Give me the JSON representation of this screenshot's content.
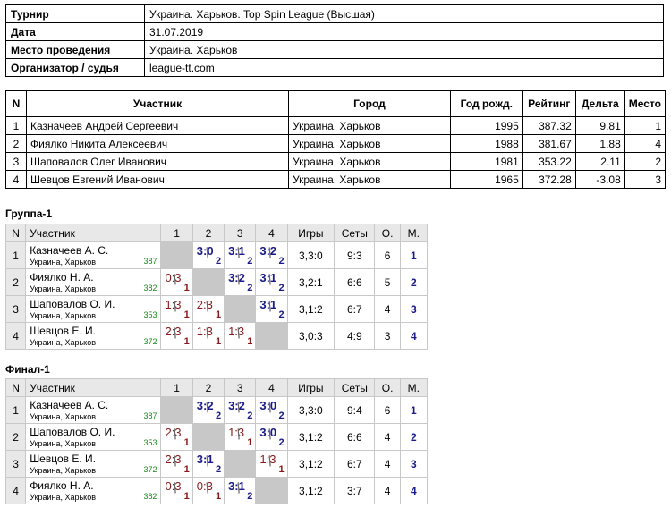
{
  "info": [
    {
      "label": "Турнир",
      "value": "Украина. Харьков. Top Spin League (Высшая)"
    },
    {
      "label": "Дата",
      "value": "31.07.2019"
    },
    {
      "label": "Место проведения",
      "value": "Украина. Харьков"
    },
    {
      "label": "Организатор / судья",
      "value": "league-tt.com"
    }
  ],
  "participants": {
    "headers": [
      "N",
      "Участник",
      "Город",
      "Год рожд.",
      "Рейтинг",
      "Дельта",
      "Место"
    ],
    "rows": [
      {
        "n": "1",
        "name": "Казначеев Андрей Сергеевич",
        "city": "Украина, Харьков",
        "year": "1995",
        "rating": "387.32",
        "delta": "9.81",
        "place": "1"
      },
      {
        "n": "2",
        "name": "Фиялко Никита Алексеевич",
        "city": "Украина, Харьков",
        "year": "1988",
        "rating": "381.67",
        "delta": "1.88",
        "place": "4"
      },
      {
        "n": "3",
        "name": "Шаповалов Олег Иванович",
        "city": "Украина, Харьков",
        "year": "1981",
        "rating": "353.22",
        "delta": "2.11",
        "place": "2"
      },
      {
        "n": "4",
        "name": "Шевцов Евгений Иванович",
        "city": "Украина, Харьков",
        "year": "1965",
        "rating": "372.28",
        "delta": "-3.08",
        "place": "3"
      }
    ]
  },
  "groups": [
    {
      "title": "Группа-1",
      "headers": [
        "N",
        "Участник",
        "1",
        "2",
        "3",
        "4",
        "Игры",
        "Сеты",
        "О.",
        "М."
      ],
      "rows": [
        {
          "n": "1",
          "name": "Казначеев А. С.",
          "city": "Украина, Харьков",
          "rating": "387",
          "results": [
            null,
            {
              "s": "3:0",
              "p": "2",
              "w": true
            },
            {
              "s": "3:1",
              "p": "2",
              "w": true
            },
            {
              "s": "3:2",
              "p": "2",
              "w": true
            }
          ],
          "games": "3,3:0",
          "sets": "9:3",
          "points": "6",
          "place": "1"
        },
        {
          "n": "2",
          "name": "Фиялко Н. А.",
          "city": "Украина, Харьков",
          "rating": "382",
          "results": [
            {
              "s": "0:3",
              "p": "1",
              "w": false
            },
            null,
            {
              "s": "3:2",
              "p": "2",
              "w": true
            },
            {
              "s": "3:1",
              "p": "2",
              "w": true
            }
          ],
          "games": "3,2:1",
          "sets": "6:6",
          "points": "5",
          "place": "2"
        },
        {
          "n": "3",
          "name": "Шаповалов О. И.",
          "city": "Украина, Харьков",
          "rating": "353",
          "results": [
            {
              "s": "1:3",
              "p": "1",
              "w": false
            },
            {
              "s": "2:3",
              "p": "1",
              "w": false
            },
            null,
            {
              "s": "3:1",
              "p": "2",
              "w": true
            }
          ],
          "games": "3,1:2",
          "sets": "6:7",
          "points": "4",
          "place": "3"
        },
        {
          "n": "4",
          "name": "Шевцов Е. И.",
          "city": "Украина, Харьков",
          "rating": "372",
          "results": [
            {
              "s": "2:3",
              "p": "1",
              "w": false
            },
            {
              "s": "1:3",
              "p": "1",
              "w": false
            },
            {
              "s": "1:3",
              "p": "1",
              "w": false
            },
            null
          ],
          "games": "3,0:3",
          "sets": "4:9",
          "points": "3",
          "place": "4"
        }
      ]
    },
    {
      "title": "Финал-1",
      "headers": [
        "N",
        "Участник",
        "1",
        "2",
        "3",
        "4",
        "Игры",
        "Сеты",
        "О.",
        "М."
      ],
      "rows": [
        {
          "n": "1",
          "name": "Казначеев А. С.",
          "city": "Украина, Харьков",
          "rating": "387",
          "results": [
            null,
            {
              "s": "3:2",
              "p": "2",
              "w": true
            },
            {
              "s": "3:2",
              "p": "2",
              "w": true
            },
            {
              "s": "3:0",
              "p": "2",
              "w": true
            }
          ],
          "games": "3,3:0",
          "sets": "9:4",
          "points": "6",
          "place": "1"
        },
        {
          "n": "2",
          "name": "Шаповалов О. И.",
          "city": "Украина, Харьков",
          "rating": "353",
          "results": [
            {
              "s": "2:3",
              "p": "1",
              "w": false
            },
            null,
            {
              "s": "1:3",
              "p": "1",
              "w": false
            },
            {
              "s": "3:0",
              "p": "2",
              "w": true
            }
          ],
          "games": "3,1:2",
          "sets": "6:6",
          "points": "4",
          "place": "2"
        },
        {
          "n": "3",
          "name": "Шевцов Е. И.",
          "city": "Украина, Харьков",
          "rating": "372",
          "results": [
            {
              "s": "2:3",
              "p": "1",
              "w": false
            },
            {
              "s": "3:1",
              "p": "2",
              "w": true
            },
            null,
            {
              "s": "1:3",
              "p": "1",
              "w": false
            }
          ],
          "games": "3,1:2",
          "sets": "6:7",
          "points": "4",
          "place": "3"
        },
        {
          "n": "4",
          "name": "Фиялко Н. А.",
          "city": "Украина, Харьков",
          "rating": "382",
          "results": [
            {
              "s": "0:3",
              "p": "1",
              "w": false
            },
            {
              "s": "0:3",
              "p": "1",
              "w": false
            },
            {
              "s": "3:1",
              "p": "2",
              "w": true
            },
            null
          ],
          "games": "3,1:2",
          "sets": "3:7",
          "points": "4",
          "place": "4"
        }
      ]
    }
  ]
}
